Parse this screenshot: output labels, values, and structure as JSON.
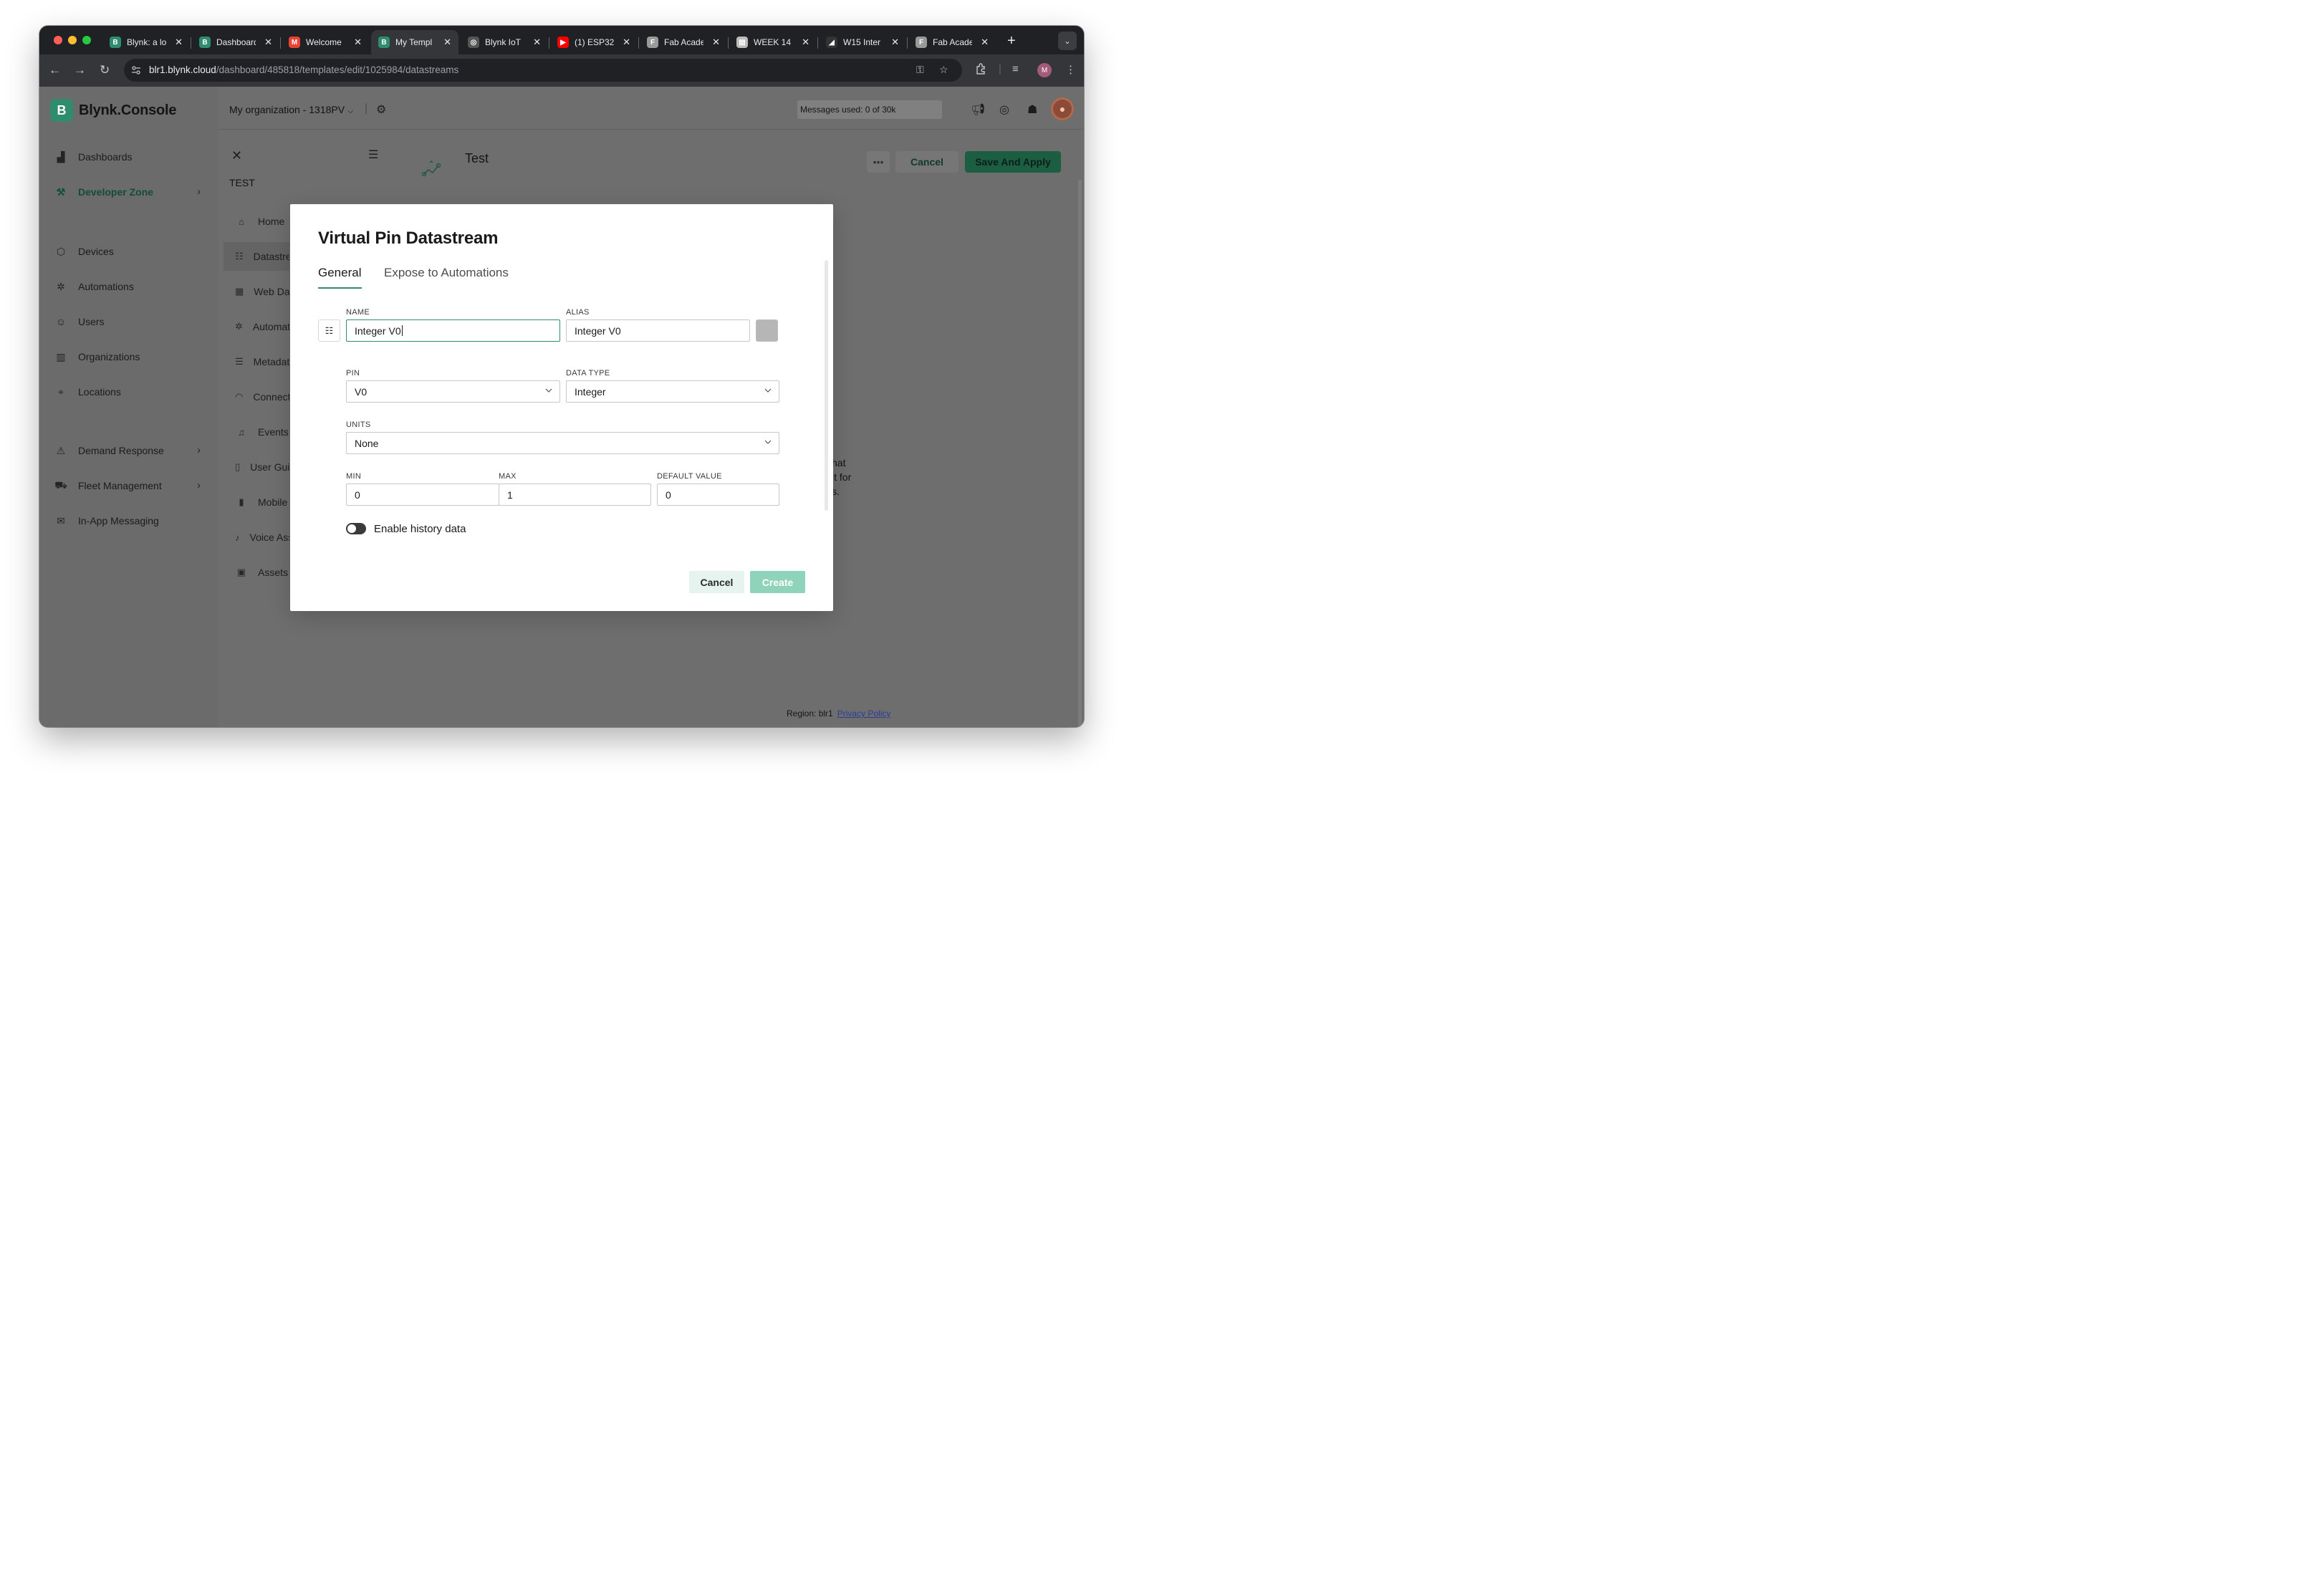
{
  "browser": {
    "tabs": [
      {
        "title": "Blynk: a lo",
        "icon": "blynk-favicon",
        "color": "#2f8d6d"
      },
      {
        "title": "Dashboard",
        "icon": "blynk-favicon",
        "color": "#2f8d6d"
      },
      {
        "title": "Welcome",
        "icon": "gmail-favicon",
        "color": "#ea4335"
      },
      {
        "title": "My Templ",
        "icon": "blynk-favicon",
        "color": "#2f8d6d"
      },
      {
        "title": "Blynk IoT",
        "icon": "globe-favicon",
        "color": "#555"
      },
      {
        "title": "(1) ESP32",
        "icon": "youtube-favicon",
        "color": "#ff0000"
      },
      {
        "title": "Fab Acade",
        "icon": "fabacademy-favicon",
        "color": "#999"
      },
      {
        "title": "WEEK 14",
        "icon": "doc-favicon",
        "color": "#bbb"
      },
      {
        "title": "W15 Inter",
        "icon": "notion-favicon",
        "color": "#333"
      },
      {
        "title": "Fab Acade",
        "icon": "fabacademy-favicon",
        "color": "#999"
      }
    ],
    "active_tab_index": 3,
    "url_host": "blr1.blynk.cloud",
    "url_path": "/dashboard/485818/templates/edit/1025984/datastreams",
    "profile_initial": "M"
  },
  "sidebar": {
    "brand": "Blynk.Console",
    "brand_logo": "B",
    "items": [
      {
        "label": "Dashboards",
        "icon": "chart-icon"
      },
      {
        "label": "Developer Zone",
        "icon": "tools-icon",
        "has_children": true
      },
      {
        "label": "Devices",
        "icon": "cube-icon"
      },
      {
        "label": "Automations",
        "icon": "automation-icon"
      },
      {
        "label": "Users",
        "icon": "users-icon"
      },
      {
        "label": "Organizations",
        "icon": "building-icon"
      },
      {
        "label": "Locations",
        "icon": "location-pin-icon"
      },
      {
        "label": "Demand Response",
        "icon": "demand-icon",
        "has_children": true
      },
      {
        "label": "Fleet Management",
        "icon": "truck-icon",
        "has_children": true
      },
      {
        "label": "In-App Messaging",
        "icon": "message-icon"
      }
    ]
  },
  "topbar": {
    "org": "My organization - 1318PV",
    "messages": "Messages used: 0 of 30k"
  },
  "template": {
    "label": "TEST",
    "title": "Test",
    "cancel_label": "Cancel",
    "save_label": "Save And Apply",
    "more_label": "•••",
    "sub_nav": [
      {
        "label": "Home",
        "icon": "home-icon"
      },
      {
        "label": "Datastreams",
        "icon": "datastream-icon"
      },
      {
        "label": "Web Dashboard",
        "icon": "web-dashboard-icon"
      },
      {
        "label": "Automations",
        "icon": "automation-icon"
      },
      {
        "label": "Metadata",
        "icon": "list-icon"
      },
      {
        "label": "Connection",
        "icon": "wifi-icon"
      },
      {
        "label": "Events",
        "icon": "bell-icon"
      },
      {
        "label": "User Guides",
        "icon": "book-icon"
      },
      {
        "label": "Mobile",
        "icon": "mobile-icon"
      },
      {
        "label": "Voice Assistants",
        "icon": "mic-icon"
      },
      {
        "label": "Assets",
        "icon": "assets-icon"
      }
    ],
    "bg_text": [
      "hat",
      "it for",
      "s."
    ]
  },
  "modal": {
    "title": "Virtual Pin Datastream",
    "tabs": [
      "General",
      "Expose to Automations"
    ],
    "active_tab": 0,
    "name_label": "NAME",
    "name_value": "Integer V0",
    "alias_label": "ALIAS",
    "alias_value": "Integer V0",
    "pin_label": "PIN",
    "pin_value": "V0",
    "data_type_label": "DATA TYPE",
    "data_type_value": "Integer",
    "units_label": "UNITS",
    "units_value": "None",
    "min_label": "MIN",
    "min_value": "0",
    "max_label": "MAX",
    "max_value": "1",
    "default_label": "DEFAULT VALUE",
    "default_value": "0",
    "history_label": "Enable history data",
    "history_enabled": false,
    "cancel_label": "Cancel",
    "create_label": "Create"
  },
  "footer": {
    "region": "Region: blr1",
    "privacy": "Privacy Policy"
  },
  "colors": {
    "accent": "#2f8d6d",
    "save_button": "#1b5e42",
    "create_disabled": "#8fd3bb"
  }
}
